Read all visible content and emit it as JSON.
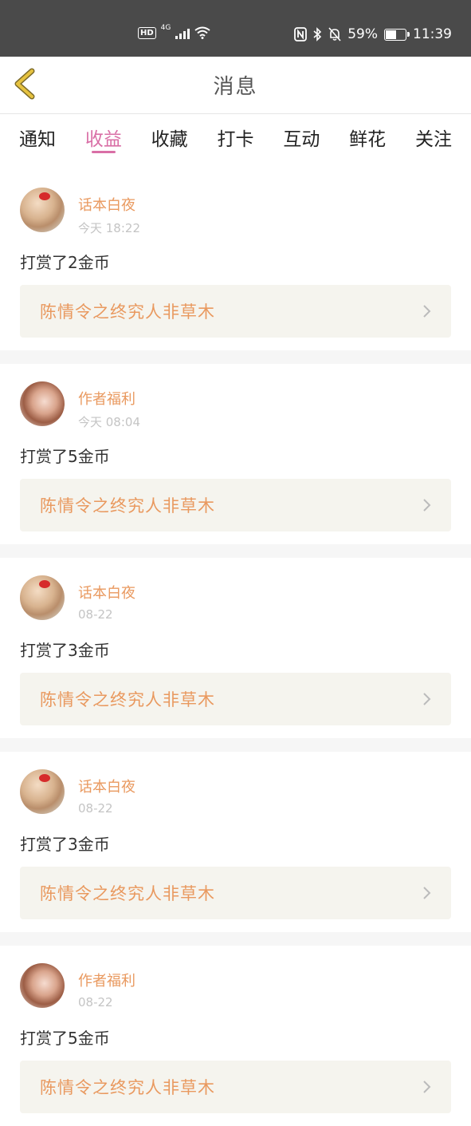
{
  "status_bar": {
    "hd": "HD",
    "network": "4G",
    "battery_pct": "59%",
    "time": "11:39",
    "battery_level": 0.59,
    "icons": [
      "hd-icon",
      "signal-icon",
      "wifi-icon",
      "nfc-icon",
      "bluetooth-icon",
      "mute-bell-icon",
      "battery-icon"
    ]
  },
  "header": {
    "title": "消息",
    "back_icon": "chevron-left-icon"
  },
  "tabs": [
    {
      "label": "通知"
    },
    {
      "label": "收益",
      "active": true
    },
    {
      "label": "收藏"
    },
    {
      "label": "打卡"
    },
    {
      "label": "互动"
    },
    {
      "label": "鲜花"
    },
    {
      "label": "关注"
    }
  ],
  "messages": [
    {
      "name": "话本白夜",
      "time": "今天 18:22",
      "text": "打赏了2金币",
      "book": "陈情令之终究人非草木"
    },
    {
      "name": "作者福利",
      "time": "今天 08:04",
      "text": "打赏了5金币",
      "book": "陈情令之终究人非草木"
    },
    {
      "name": "话本白夜",
      "time": "08-22",
      "text": "打赏了3金币",
      "book": "陈情令之终究人非草木"
    },
    {
      "name": "话本白夜",
      "time": "08-22",
      "text": "打赏了3金币",
      "book": "陈情令之终究人非草木"
    },
    {
      "name": "作者福利",
      "time": "08-22",
      "text": "打赏了5金币",
      "book": "陈情令之终究人非草木"
    }
  ],
  "colors": {
    "accent": "#d96fa6",
    "name": "#e9995f",
    "back_arrow": "#e6c23f"
  }
}
